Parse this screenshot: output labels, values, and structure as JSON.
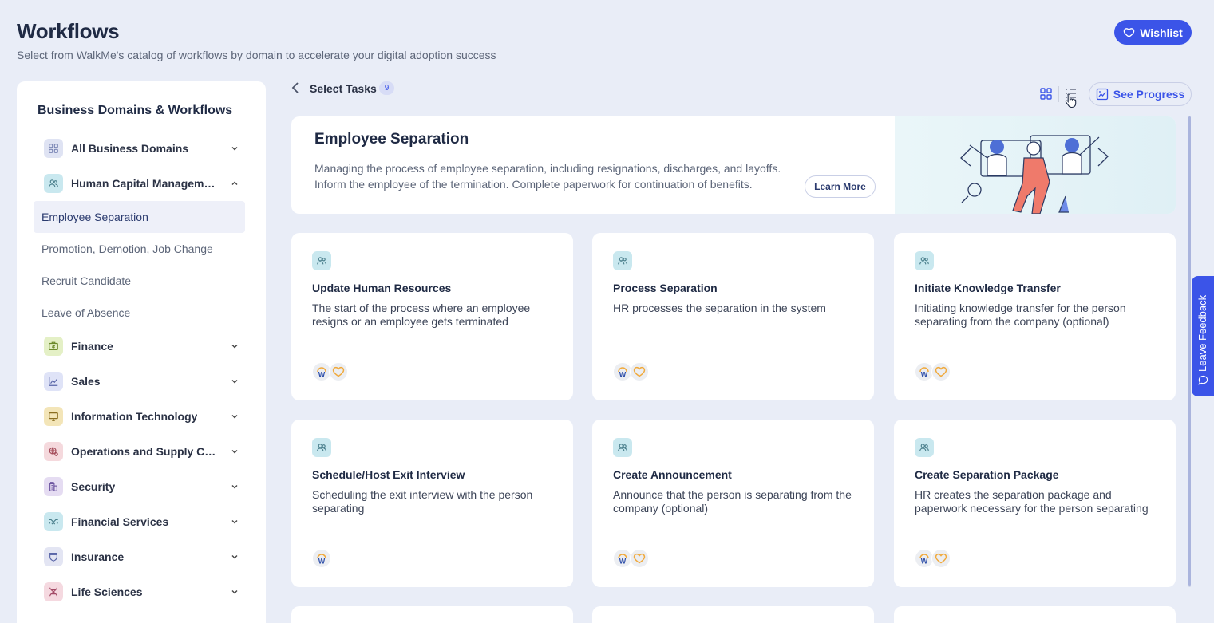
{
  "header": {
    "title": "Workflows",
    "subtitle": "Select from WalkMe's catalog of workflows by domain to accelerate your digital adoption success",
    "wishlist_label": "Wishlist"
  },
  "sidebar": {
    "title": "Business Domains & Workflows",
    "all_domains": "All Business Domains",
    "hcm": "Human Capital Management",
    "sub_items": [
      "Employee Separation",
      "Promotion, Demotion, Job Change",
      "Recruit Candidate",
      "Leave of Absence"
    ],
    "domains": [
      "Finance",
      "Sales",
      "Information Technology",
      "Operations and Supply Chai...",
      "Security",
      "Financial Services",
      "Insurance",
      "Life Sciences"
    ]
  },
  "toolbar": {
    "select_tasks": "Select Tasks",
    "count": "9",
    "see_progress": "See Progress"
  },
  "banner": {
    "title": "Employee Separation",
    "desc_line1": "Managing the process of employee separation, including resignations, discharges, and layoffs.",
    "desc_line2": "Inform the employee of the termination. Complete paperwork for continuation of benefits.",
    "learn_more": "Learn More"
  },
  "cards": [
    {
      "title": "Update Human Resources",
      "desc": "The start of the process where an employee resigns or an employee gets terminated"
    },
    {
      "title": "Process Separation",
      "desc": "HR processes the separation in the system"
    },
    {
      "title": "Initiate Knowledge Transfer",
      "desc": "Initiating knowledge transfer for the person separating from the company (optional)"
    },
    {
      "title": "Schedule/Host Exit Interview",
      "desc": "Scheduling the exit interview with the person separating"
    },
    {
      "title": "Create Announcement",
      "desc": "Announce that the person is separating from the company (optional)"
    },
    {
      "title": "Create Separation Package",
      "desc": "HR creates the separation package and paperwork necessary for the person separating"
    }
  ],
  "feedback": "Leave Feedback",
  "colors": {
    "accent": "#3b54e8",
    "background": "#e9edf7"
  }
}
